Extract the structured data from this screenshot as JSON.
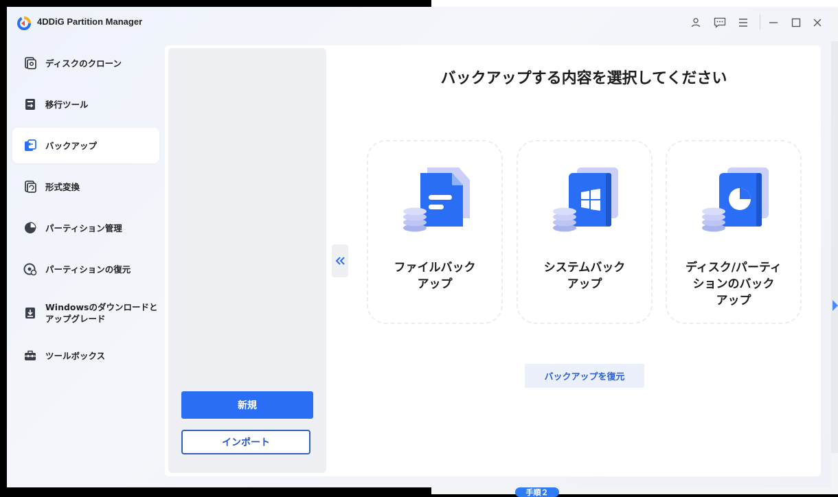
{
  "app": {
    "title": "4DDiG Partition Manager"
  },
  "background": {
    "badge": "手順２"
  },
  "sidebar": {
    "items": [
      {
        "label": "ディスクのクローン",
        "icon": "disk-clone-icon"
      },
      {
        "label": "移行ツール",
        "icon": "migration-icon"
      },
      {
        "label": "バックアップ",
        "icon": "backup-icon",
        "active": true
      },
      {
        "label": "形式変換",
        "icon": "format-convert-icon"
      },
      {
        "label": "パーティション管理",
        "icon": "partition-pie-icon"
      },
      {
        "label": "パーティションの復元",
        "icon": "partition-restore-icon"
      },
      {
        "label": "Windowsのダウンロードと\nアップグレード",
        "icon": "windows-download-icon"
      },
      {
        "label": "ツールボックス",
        "icon": "toolbox-icon"
      }
    ]
  },
  "left_panel": {
    "new_label": "新規",
    "import_label": "インポート"
  },
  "main": {
    "heading": "バックアップする内容を選択してください",
    "cards": [
      {
        "label": "ファイルバック\nアップ",
        "icon": "file-backup-icon"
      },
      {
        "label": "システムバック\nアップ",
        "icon": "system-backup-icon"
      },
      {
        "label": "ディスク/パーティ\nションのバック\nアップ",
        "icon": "disk-partition-backup-icon"
      }
    ],
    "restore_label": "バックアップを復元"
  },
  "colors": {
    "accent": "#2a6ef6",
    "accent_dark": "#2e5fc4",
    "icon_light": "#c9cff6"
  }
}
